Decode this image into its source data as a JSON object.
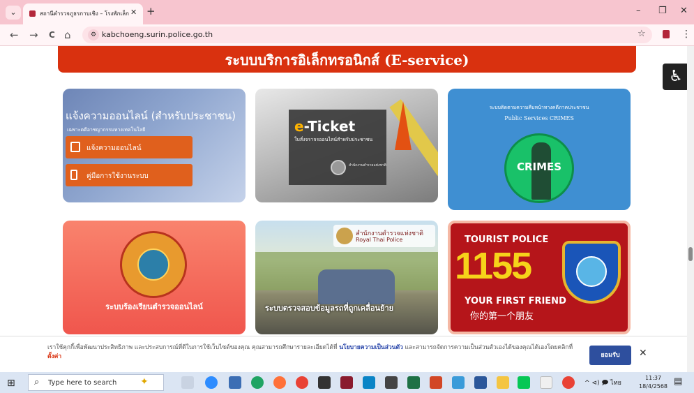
{
  "browser": {
    "tab_title": "สถานีตำรวจภูธรกาบเชิง – โรงพักเล็ก",
    "tab_close": "✕",
    "new_tab": "+",
    "minimize": "–",
    "maximize": "❐",
    "close": "✕",
    "back": "←",
    "forward": "→",
    "reload": "C",
    "home": "⌂",
    "url": "kabchoeng.surin.police.go.th",
    "bookmark": "☆",
    "menu": "⋮",
    "tab_menu": "⌄"
  },
  "page": {
    "eservice_title": "ระบบบริการอิเล็กทรอนิกส์ (E-service)",
    "accessibility": "♿",
    "cards": {
      "report": {
        "title": "แจ้งความออนไลน์ (สำหรับประชาชน)",
        "subtitle": "เฉพาะคดีอาชญากรรมทางเทคโนโลยี",
        "button1": "แจ้งความออนไลน์",
        "button2": "คู่มือการใช้งานระบบ"
      },
      "eticket": {
        "title_e": "e",
        "title_rest": "-Ticket",
        "subtitle": "ใบสั่งจราจรออนไลน์สำหรับประชาชน",
        "seal_text": "สำนักงานตำรวจแห่งชาติ"
      },
      "crimes": {
        "title_th": "ระบบติดตามความคืบหน้าทางคดีภาคประชาชน",
        "title_en": "Public Services CRIMES",
        "label": "CRIMES"
      },
      "complaint": {
        "title": "ระบบร้องเรียนตำรวจออนไลน์"
      },
      "vehicle": {
        "logo_th": "สำนักงานตำรวจแห่งชาติ",
        "logo_en": "Royal Thai Police",
        "title": "ระบบตรวจสอบข้อมูลรถที่ถูกเคลื่อนย้าย"
      },
      "tourist": {
        "line1": "TOURIST POLICE",
        "number": "1155",
        "line2": "YOUR FIRST FRIEND",
        "line3": "你的第一个朋友"
      }
    }
  },
  "cookie": {
    "text": "เราใช้คุกกี้เพื่อพัฒนาประสิทธิภาพ และประสบการณ์ที่ดีในการใช้เว็บไซต์ของคุณ คุณสามารถศึกษารายละเอียดได้ที่",
    "policy_link": "นโยบายความเป็นส่วนตัว",
    "text2": "และสามารถจัดการความเป็นส่วนตัวเองได้ของคุณได้เองโดยคลิกที่",
    "settings_link": "ตั้งค่า",
    "accept": "ยอมรับ",
    "close": "✕"
  },
  "taskbar": {
    "search_placeholder": "Type here to search",
    "start": "⊞",
    "search_icon": "⌕",
    "tray_text": "^ ⊲) 🗩 ไทย",
    "time": "11:37",
    "date": "18/4/2568",
    "notification": "▤"
  },
  "colors": {
    "tab_bar": "#f7c5cf",
    "eservice_banner": "#d9310f",
    "accept_button": "#2e4f9e"
  }
}
